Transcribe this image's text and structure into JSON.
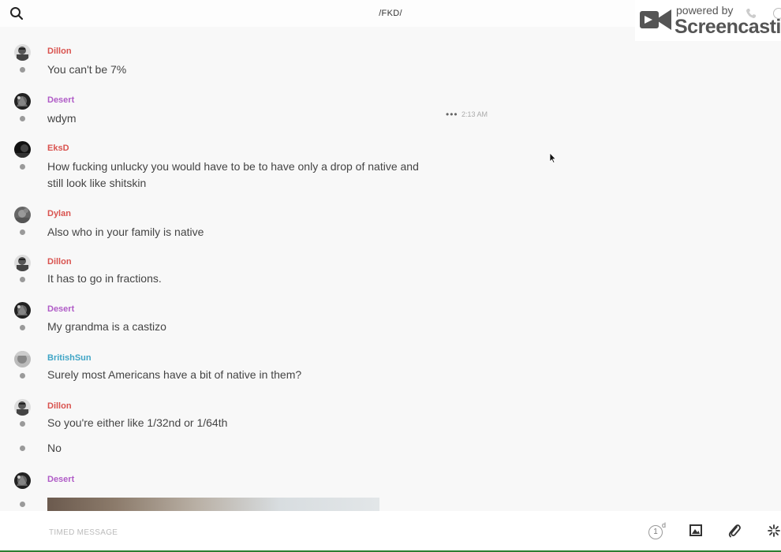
{
  "header": {
    "title": "/FKD/",
    "search_icon": "search-icon"
  },
  "watermark": {
    "powered_by": "powered by",
    "brand": "Screencastify"
  },
  "messages": [
    {
      "author": "Dillon",
      "color": "#d9534f",
      "text": "You can't be 7%"
    },
    {
      "author": "Desert",
      "color": "#b05cc7",
      "text": "wdym",
      "timestamp": "2:13 AM",
      "more": "•••"
    },
    {
      "author": "EksD",
      "color": "#d9534f",
      "text": "How fucking unlucky you would have to be to have only a drop of native and still look like shitskin"
    },
    {
      "author": "Dylan",
      "color": "#d9534f",
      "text": "Also who in your family is native"
    },
    {
      "author": "Dillon",
      "color": "#d9534f",
      "text": "It has to go in fractions."
    },
    {
      "author": "Desert",
      "color": "#b05cc7",
      "text": "My grandma is a castizo"
    },
    {
      "author": "BritishSun",
      "color": "#3fa5c6",
      "text": "Surely most Americans have a bit of native in them?"
    },
    {
      "author": "Dillon",
      "color": "#d9534f",
      "text": "So you're either like 1/32nd or 1/64th"
    },
    {
      "author": "",
      "text": "No"
    },
    {
      "author": "Desert",
      "color": "#b05cc7",
      "text": ""
    }
  ],
  "composer": {
    "placeholder": "TIMED MESSAGE",
    "timer_value": "1",
    "timer_unit": "d"
  }
}
